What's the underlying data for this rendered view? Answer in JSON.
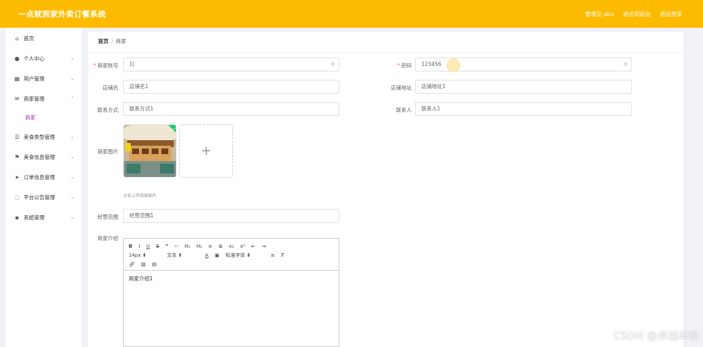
{
  "app": {
    "title": "一点就到家外卖订餐系统"
  },
  "header": {
    "user": "管理员 abo",
    "back_front": "退出到前台",
    "logout": "退出登录"
  },
  "sidebar": {
    "items": [
      {
        "label": "首页",
        "icon": "home-icon"
      },
      {
        "label": "个人中心",
        "icon": "user-icon"
      },
      {
        "label": "用户管理",
        "icon": "users-icon"
      },
      {
        "label": "商家管理",
        "icon": "mail-icon"
      },
      {
        "label": "美食类型管理",
        "icon": "list-icon"
      },
      {
        "label": "美食信息管理",
        "icon": "flag-icon"
      },
      {
        "label": "订单信息管理",
        "icon": "send-icon"
      },
      {
        "label": "平台公告管理",
        "icon": "globe-icon"
      },
      {
        "label": "系统管理",
        "icon": "grid-icon"
      }
    ],
    "sub_active": "商家"
  },
  "breadcrumb": {
    "home": "首页",
    "current": "商家"
  },
  "form": {
    "account_label": "商家账号",
    "account_value": "1",
    "password_label": "密码",
    "password_value": "123456",
    "shop_name_label": "店铺名",
    "shop_name_value": "店铺名1",
    "shop_addr_label": "店铺地址",
    "shop_addr_value": "店铺地址1",
    "contact_label": "联系方式",
    "contact_value": "联系方式1",
    "person_label": "联系人",
    "person_value": "联系人1",
    "image_label": "商家图片",
    "upload_tip": "点击上传商家图片",
    "scope_label": "经营范围",
    "scope_value": "经营范围1",
    "intro_label": "商家介绍"
  },
  "editor": {
    "font_size": "14px",
    "text_type": "文本",
    "font_family": "标准字体",
    "content": "商家介绍1",
    "toolbar_row1": [
      "B",
      "I",
      "U",
      "S",
      "❞",
      "‹›",
      "H₁",
      "H₂",
      "≡",
      "≣",
      "x₂",
      "x²",
      "⇤",
      "⇥"
    ]
  },
  "watermark": "CSDN @卓越毕设"
}
